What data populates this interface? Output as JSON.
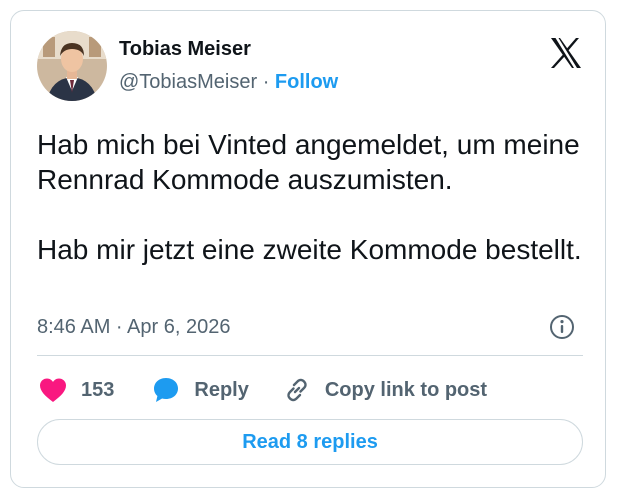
{
  "author": {
    "name": "Tobias Meiser",
    "handle": "@TobiasMeiser",
    "separator": "·",
    "follow_label": "Follow"
  },
  "tweet": {
    "paragraphs": [
      "Hab mich bei Vinted angemeldet, um meine Rennrad Kommode auszumisten.",
      "Hab mir jetzt eine zweite Kommode bestellt."
    ],
    "timestamp": "8:46 AM · Apr 6, 2026"
  },
  "actions": {
    "like_count": "153",
    "reply_label": "Reply",
    "copy_link_label": "Copy link to post"
  },
  "footer": {
    "read_replies_label": "Read 8 replies"
  },
  "icons": {
    "brand": "x-logo-icon",
    "info": "info-icon",
    "like": "heart-icon",
    "reply": "speech-bubble-icon",
    "copy": "link-icon"
  },
  "colors": {
    "accent": "#1d9bf0",
    "like": "#f91880",
    "muted": "#536471",
    "border": "#cfd9de",
    "text": "#0f1419"
  }
}
